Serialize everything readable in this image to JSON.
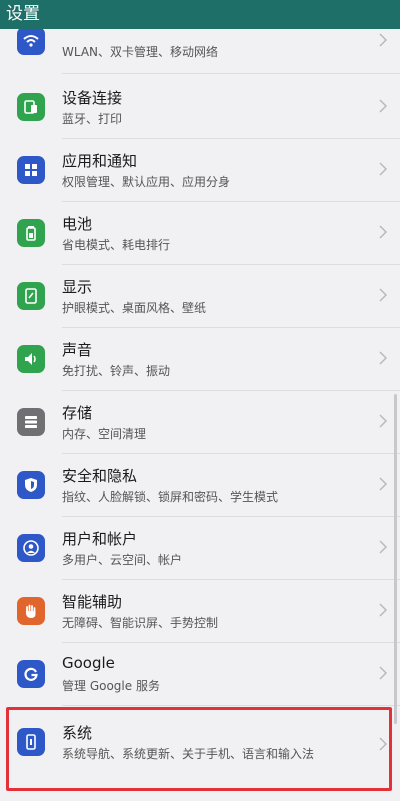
{
  "statusbar": {
    "title": "设置"
  },
  "rows": [
    {
      "title": "",
      "subtitle": "WLAN、双卡管理、移动网络",
      "icon": "wifi-icon",
      "color": "#2e57c7"
    },
    {
      "title": "设备连接",
      "subtitle": "蓝牙、打印",
      "icon": "device-connection-icon",
      "color": "#2fa34e"
    },
    {
      "title": "应用和通知",
      "subtitle": "权限管理、默认应用、应用分身",
      "icon": "apps-grid-icon",
      "color": "#2e57c7"
    },
    {
      "title": "电池",
      "subtitle": "省电模式、耗电排行",
      "icon": "battery-icon",
      "color": "#2fa34e"
    },
    {
      "title": "显示",
      "subtitle": "护眼模式、桌面风格、壁纸",
      "icon": "display-icon",
      "color": "#2fa34e"
    },
    {
      "title": "声音",
      "subtitle": "免打扰、铃声、振动",
      "icon": "speaker-icon",
      "color": "#2fa34e"
    },
    {
      "title": "存储",
      "subtitle": "内存、空间清理",
      "icon": "storage-icon",
      "color": "#6f6f74"
    },
    {
      "title": "安全和隐私",
      "subtitle": "指纹、人脸解锁、锁屏和密码、学生模式",
      "icon": "shield-icon",
      "color": "#2e57c7"
    },
    {
      "title": "用户和帐户",
      "subtitle": "多用户、云空间、帐户",
      "icon": "user-icon",
      "color": "#2e57c7"
    },
    {
      "title": "智能辅助",
      "subtitle": "无障碍、智能识屏、手势控制",
      "icon": "hand-icon",
      "color": "#e0662d"
    },
    {
      "title": "Google",
      "subtitle": "管理 Google 服务",
      "icon": "google-icon",
      "color": "#2e57c7"
    },
    {
      "title": "系统",
      "subtitle": "系统导航、系统更新、关于手机、语言和输入法",
      "icon": "system-phone-icon",
      "color": "#2e57c7"
    }
  ]
}
